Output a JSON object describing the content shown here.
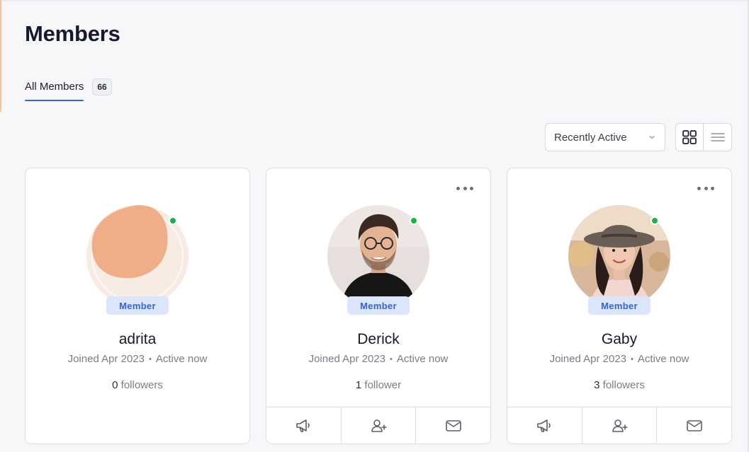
{
  "page": {
    "title": "Members"
  },
  "tabs": [
    {
      "label": "All Members",
      "count": "66"
    }
  ],
  "sort": {
    "selected": "Recently Active"
  },
  "view_toggle": {
    "options": [
      "grid-view-icon",
      "list-view-icon"
    ],
    "active": "grid"
  },
  "colors": {
    "accent": "#3b64e0",
    "badge_bg": "#dbe5fb",
    "badge_text": "#3563d9",
    "online": "#17b34b"
  },
  "members": [
    {
      "name": "adrita",
      "role": "Member",
      "joined": "Joined Apr 2023",
      "activity": "Active now",
      "followers_count": "0",
      "followers_label": "followers",
      "avatar": "default-avatar",
      "online": true
    },
    {
      "name": "Derick",
      "role": "Member",
      "joined": "Joined Apr 2023",
      "activity": "Active now",
      "followers_count": "1",
      "followers_label": "follower",
      "avatar": "photo-man-glasses",
      "online": true
    },
    {
      "name": "Gaby",
      "role": "Member",
      "joined": "Joined Apr 2023",
      "activity": "Active now",
      "followers_count": "3",
      "followers_label": "followers",
      "avatar": "photo-woman-hat",
      "online": true
    }
  ],
  "card_actions": [
    "megaphone-icon",
    "add-friend-icon",
    "mail-icon"
  ],
  "dot_separator": "•"
}
